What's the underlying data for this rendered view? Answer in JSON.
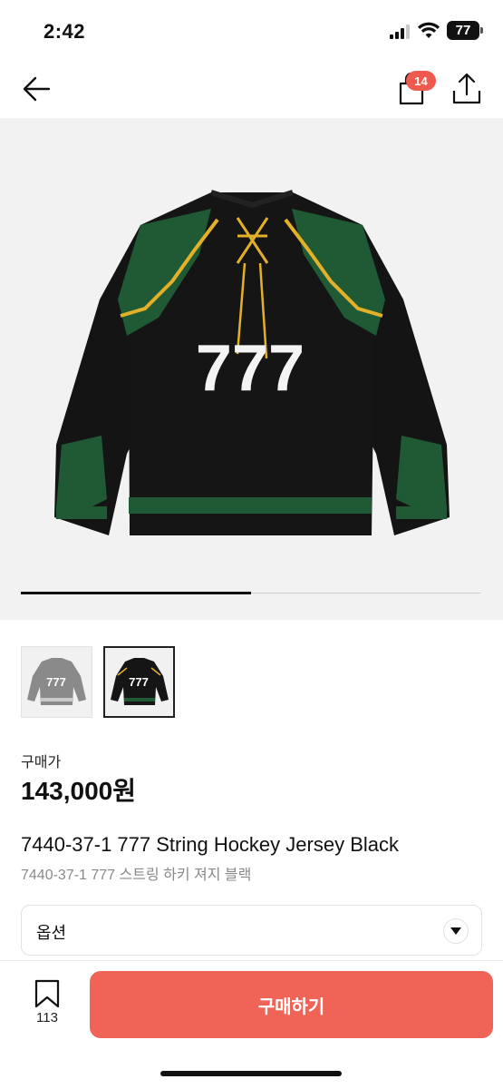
{
  "status_bar": {
    "time": "2:42",
    "battery": "77",
    "icons": [
      "signal-icon",
      "wifi-icon",
      "battery-icon"
    ]
  },
  "nav": {
    "back_icon": "back-arrow-icon",
    "cart_icon": "shopping-bag-icon",
    "cart_badge": "14",
    "share_icon": "share-icon",
    "badge_color": "#ef5a4f"
  },
  "gallery": {
    "jersey_number": "777",
    "progress": 0.5,
    "thumbnails": [
      {
        "color": "grey",
        "number": "777",
        "selected": false
      },
      {
        "color": "black",
        "number": "777",
        "selected": true
      }
    ]
  },
  "product": {
    "price_label": "구매가",
    "price": "143,000원",
    "title": "7440-37-1 777 String Hockey Jersey Black",
    "subtitle": "7440-37-1 777 스트링 하키 져지 블랙"
  },
  "option": {
    "label": "옵션",
    "chevron_icon": "chevron-down-icon"
  },
  "bottom_bar": {
    "bookmark_icon": "bookmark-icon",
    "bookmark_count": "113",
    "buy_label": "구매하기",
    "buy_color": "#ef6456"
  }
}
